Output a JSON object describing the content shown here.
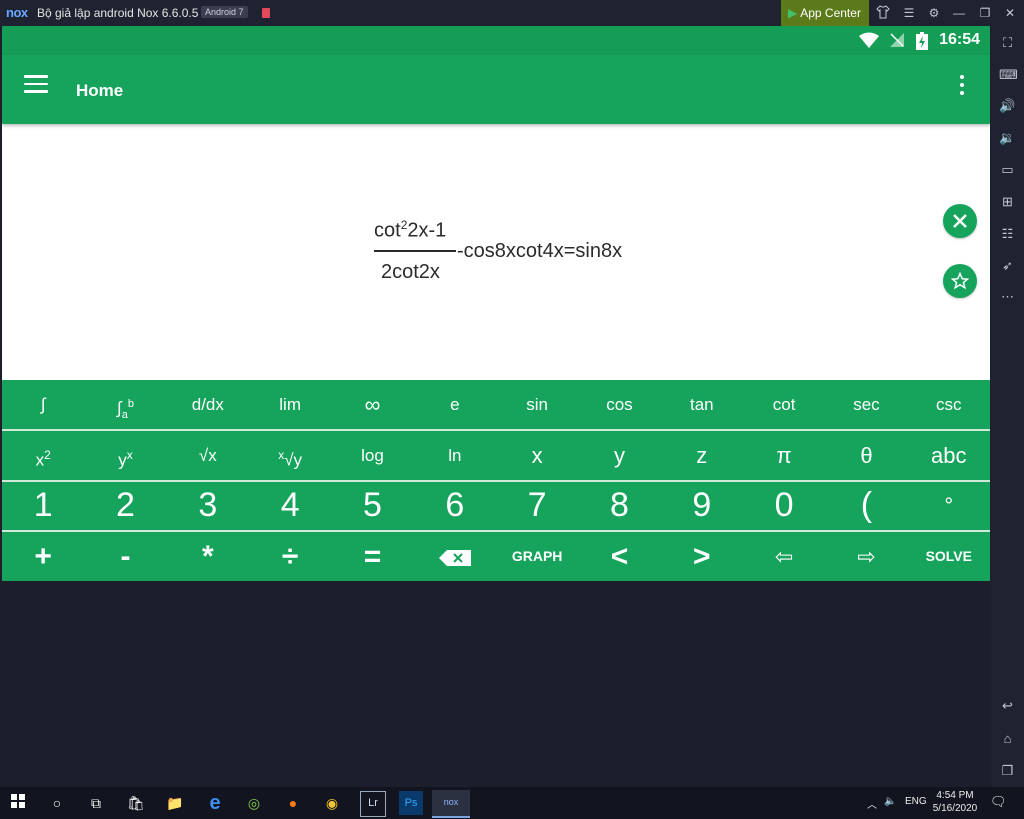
{
  "window": {
    "logo": "nox",
    "title": "Bộ giả lập android Nox 6.6.0.5",
    "android_badge": "Android 7",
    "app_center_label": "App Center"
  },
  "status_bar": {
    "time": "16:54"
  },
  "app_bar": {
    "title": "Home"
  },
  "equation": {
    "numerator_prefix": "cot",
    "numerator_exp": "2",
    "numerator_suffix": "2x-1",
    "denominator": "2cot2x",
    "rest": "-cos8xcot4x=sin8x"
  },
  "keypad": {
    "row1": [
      "∫",
      "∫",
      "d/dx",
      "lim",
      "∞",
      "e",
      "sin",
      "cos",
      "tan",
      "cot",
      "sec",
      "csc"
    ],
    "row1_limits": {
      "upper": "b",
      "lower": "a"
    },
    "row2": [
      "x",
      "y",
      "√x",
      "√y",
      "log",
      "ln",
      "x",
      "y",
      "z",
      "π",
      "θ",
      "abc"
    ],
    "row2_sups": {
      "x2": "2",
      "yx": "x",
      "xroot": "x"
    },
    "row3": [
      "1",
      "2",
      "3",
      "4",
      "5",
      "6",
      "7",
      "8",
      "9",
      "0",
      "(",
      "°"
    ],
    "row4": [
      "+",
      "-",
      "*",
      "÷",
      "=",
      "",
      "GRAPH",
      "<",
      ">",
      "⇦",
      "⇨",
      "SOLVE"
    ]
  },
  "taskbar": {
    "language": "ENG",
    "time": "4:54 PM",
    "date": "5/16/2020",
    "apps": [
      "Lr",
      "Ps"
    ]
  },
  "colors": {
    "accent_green": "#16a35b",
    "status_green": "#149d55",
    "app_center_green": "#5b7a1a",
    "emulator_bg": "#1c1f2b"
  },
  "icons": {
    "sidebar": [
      "fullscreen-icon",
      "keyboard-icon",
      "volume-up-icon",
      "volume-down-icon",
      "screen-icon",
      "add-apk-icon",
      "multi-instance-icon",
      "rocket-icon",
      "more-icon",
      "back-icon",
      "home-icon",
      "recents-icon"
    ]
  }
}
